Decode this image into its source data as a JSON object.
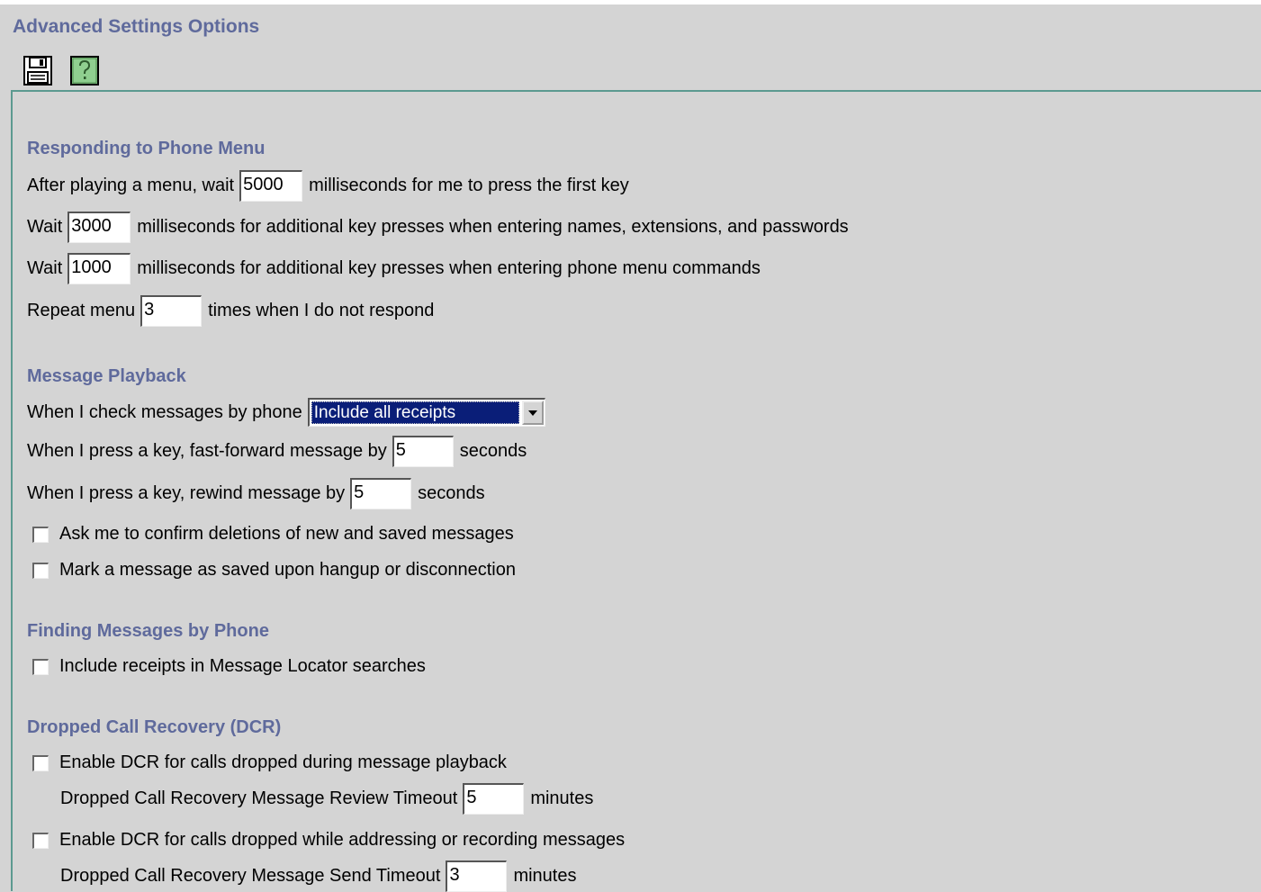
{
  "page": {
    "title": "Advanced Settings Options"
  },
  "toolbar": {
    "save_icon": "floppy-disk-save-icon",
    "help_icon": "question-mark-help-icon"
  },
  "sections": {
    "phone_menu": {
      "heading": "Responding to Phone Menu",
      "first_key": {
        "prefix": "After playing a menu, wait",
        "value": "5000",
        "suffix": "milliseconds for me to press the first key"
      },
      "additional_names": {
        "prefix": "Wait",
        "value": "3000",
        "suffix": "milliseconds for additional key presses when entering names, extensions, and passwords"
      },
      "additional_commands": {
        "prefix": "Wait",
        "value": "1000",
        "suffix": "milliseconds for additional key presses when entering phone menu commands"
      },
      "repeat_menu": {
        "prefix": "Repeat menu",
        "value": "3",
        "suffix": "times when I do not respond"
      }
    },
    "playback": {
      "heading": "Message Playback",
      "check_by_phone": {
        "label": "When I check messages by phone",
        "selected": "Include all receipts"
      },
      "fast_forward": {
        "prefix": "When I press a key, fast-forward message by",
        "value": "5",
        "suffix": "seconds"
      },
      "rewind": {
        "prefix": "When I press a key, rewind message by",
        "value": "5",
        "suffix": "seconds"
      },
      "confirm_deletions": {
        "label": "Ask me to confirm deletions of new and saved messages",
        "checked": false
      },
      "mark_saved": {
        "label": "Mark a message as saved upon hangup or disconnection",
        "checked": false
      }
    },
    "finding": {
      "heading": "Finding Messages by Phone",
      "include_receipts": {
        "label": "Include receipts in Message Locator searches",
        "checked": false
      }
    },
    "dcr": {
      "heading": "Dropped Call Recovery (DCR)",
      "playback_enable": {
        "label": "Enable DCR for calls dropped during message playback",
        "checked": false
      },
      "review_timeout": {
        "prefix": "Dropped Call Recovery Message Review Timeout",
        "value": "5",
        "suffix": "minutes"
      },
      "addressing_enable": {
        "label": "Enable DCR for calls dropped while addressing or recording messages",
        "checked": false
      },
      "send_timeout": {
        "prefix": "Dropped Call Recovery Message Send Timeout",
        "value": "3",
        "suffix": "minutes"
      }
    }
  },
  "colors": {
    "heading": "#5f6a9c",
    "background": "#d4d4d4",
    "panel_border": "#5c9a90",
    "select_highlight": "#0a1e78",
    "help_icon_fill": "#8fcf8f"
  }
}
